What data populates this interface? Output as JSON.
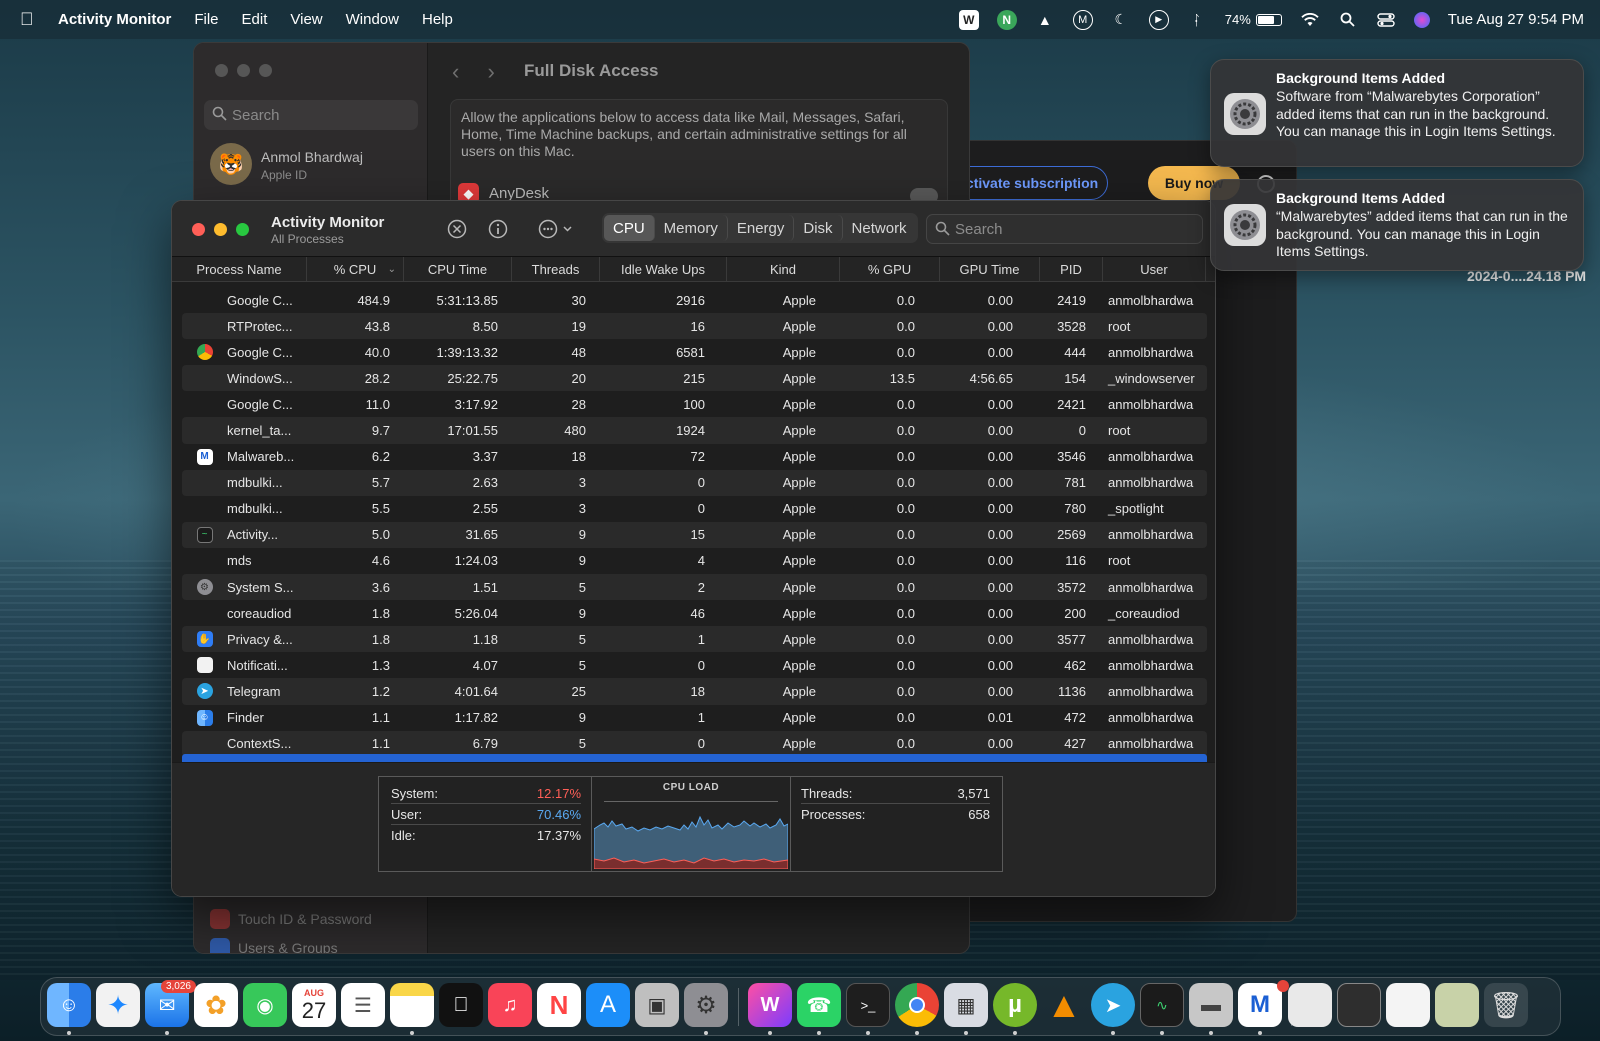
{
  "menubar": {
    "app_name": "Activity Monitor",
    "menus": [
      "File",
      "Edit",
      "View",
      "Window",
      "Help"
    ],
    "battery": "74%",
    "clock": "Tue Aug 27  9:54 PM"
  },
  "settings_window": {
    "search_placeholder": "Search",
    "user_name": "Anmol Bhardwaj",
    "user_sub": "Apple ID",
    "pane_title": "Full Disk Access",
    "description": "Allow the applications below to access data like Mail, Messages, Safari, Home, Time Machine backups, and certain administrative settings for all users on this Mac.",
    "app_row": "AnyDesk",
    "sidebar_bottom": [
      "Touch ID & Password",
      "Users & Groups"
    ]
  },
  "malwarebytes_window": {
    "activate_label": "Activate subscription",
    "buy_label": "Buy now",
    "timestamp": "2024-0....24.18 PM"
  },
  "activity_monitor": {
    "title": "Activity Monitor",
    "subtitle": "All Processes",
    "tabs": [
      "CPU",
      "Memory",
      "Energy",
      "Disk",
      "Network"
    ],
    "active_tab": "CPU",
    "search_placeholder": "Search",
    "columns": [
      "Process Name",
      "% CPU",
      "CPU Time",
      "Threads",
      "Idle Wake Ups",
      "Kind",
      "% GPU",
      "GPU Time",
      "PID",
      "User"
    ],
    "rows": [
      {
        "icon": "",
        "name": "Google C...",
        "cpu": "484.9",
        "cpu_time": "5:31:13.85",
        "threads": "30",
        "idle": "2916",
        "kind": "Apple",
        "gpu": "0.0",
        "gpu_time": "0.00",
        "pid": "2419",
        "user": "anmolbhardwa"
      },
      {
        "icon": "",
        "name": "RTProtec...",
        "cpu": "43.8",
        "cpu_time": "8.50",
        "threads": "19",
        "idle": "16",
        "kind": "Apple",
        "gpu": "0.0",
        "gpu_time": "0.00",
        "pid": "3528",
        "user": "root"
      },
      {
        "icon": "chrome",
        "name": "Google C...",
        "cpu": "40.0",
        "cpu_time": "1:39:13.32",
        "threads": "48",
        "idle": "6581",
        "kind": "Apple",
        "gpu": "0.0",
        "gpu_time": "0.00",
        "pid": "444",
        "user": "anmolbhardwa"
      },
      {
        "icon": "",
        "name": "WindowS...",
        "cpu": "28.2",
        "cpu_time": "25:22.75",
        "threads": "20",
        "idle": "215",
        "kind": "Apple",
        "gpu": "13.5",
        "gpu_time": "4:56.65",
        "pid": "154",
        "user": "_windowserver"
      },
      {
        "icon": "",
        "name": "Google C...",
        "cpu": "11.0",
        "cpu_time": "3:17.92",
        "threads": "28",
        "idle": "100",
        "kind": "Apple",
        "gpu": "0.0",
        "gpu_time": "0.00",
        "pid": "2421",
        "user": "anmolbhardwa"
      },
      {
        "icon": "",
        "name": "kernel_ta...",
        "cpu": "9.7",
        "cpu_time": "17:01.55",
        "threads": "480",
        "idle": "1924",
        "kind": "Apple",
        "gpu": "0.0",
        "gpu_time": "0.00",
        "pid": "0",
        "user": "root"
      },
      {
        "icon": "malwarebytes",
        "name": "Malwareb...",
        "cpu": "6.2",
        "cpu_time": "3.37",
        "threads": "18",
        "idle": "72",
        "kind": "Apple",
        "gpu": "0.0",
        "gpu_time": "0.00",
        "pid": "3546",
        "user": "anmolbhardwa"
      },
      {
        "icon": "",
        "name": "mdbulki...",
        "cpu": "5.7",
        "cpu_time": "2.63",
        "threads": "3",
        "idle": "0",
        "kind": "Apple",
        "gpu": "0.0",
        "gpu_time": "0.00",
        "pid": "781",
        "user": "anmolbhardwa"
      },
      {
        "icon": "",
        "name": "mdbulki...",
        "cpu": "5.5",
        "cpu_time": "2.55",
        "threads": "3",
        "idle": "0",
        "kind": "Apple",
        "gpu": "0.0",
        "gpu_time": "0.00",
        "pid": "780",
        "user": "_spotlight"
      },
      {
        "icon": "activity",
        "name": "Activity...",
        "cpu": "5.0",
        "cpu_time": "31.65",
        "threads": "9",
        "idle": "15",
        "kind": "Apple",
        "gpu": "0.0",
        "gpu_time": "0.00",
        "pid": "2569",
        "user": "anmolbhardwa"
      },
      {
        "icon": "",
        "name": "mds",
        "cpu": "4.6",
        "cpu_time": "1:24.03",
        "threads": "9",
        "idle": "4",
        "kind": "Apple",
        "gpu": "0.0",
        "gpu_time": "0.00",
        "pid": "116",
        "user": "root"
      },
      {
        "icon": "settings",
        "name": "System S...",
        "cpu": "3.6",
        "cpu_time": "1.51",
        "threads": "5",
        "idle": "2",
        "kind": "Apple",
        "gpu": "0.0",
        "gpu_time": "0.00",
        "pid": "3572",
        "user": "anmolbhardwa"
      },
      {
        "icon": "",
        "name": "coreaudiod",
        "cpu": "1.8",
        "cpu_time": "5:26.04",
        "threads": "9",
        "idle": "46",
        "kind": "Apple",
        "gpu": "0.0",
        "gpu_time": "0.00",
        "pid": "200",
        "user": "_coreaudiod"
      },
      {
        "icon": "privacy",
        "name": "Privacy &...",
        "cpu": "1.8",
        "cpu_time": "1.18",
        "threads": "5",
        "idle": "1",
        "kind": "Apple",
        "gpu": "0.0",
        "gpu_time": "0.00",
        "pid": "3577",
        "user": "anmolbhardwa"
      },
      {
        "icon": "notification",
        "name": "Notificati...",
        "cpu": "1.3",
        "cpu_time": "4.07",
        "threads": "5",
        "idle": "0",
        "kind": "Apple",
        "gpu": "0.0",
        "gpu_time": "0.00",
        "pid": "462",
        "user": "anmolbhardwa"
      },
      {
        "icon": "telegram",
        "name": "Telegram",
        "cpu": "1.2",
        "cpu_time": "4:01.64",
        "threads": "25",
        "idle": "18",
        "kind": "Apple",
        "gpu": "0.0",
        "gpu_time": "0.00",
        "pid": "1136",
        "user": "anmolbhardwa"
      },
      {
        "icon": "finder",
        "name": "Finder",
        "cpu": "1.1",
        "cpu_time": "1:17.82",
        "threads": "9",
        "idle": "1",
        "kind": "Apple",
        "gpu": "0.0",
        "gpu_time": "0.01",
        "pid": "472",
        "user": "anmolbhardwa"
      },
      {
        "icon": "",
        "name": "ContextS...",
        "cpu": "1.1",
        "cpu_time": "6.79",
        "threads": "5",
        "idle": "0",
        "kind": "Apple",
        "gpu": "0.0",
        "gpu_time": "0.00",
        "pid": "427",
        "user": "anmolbhardwa"
      }
    ],
    "stats": {
      "system_label": "System:",
      "system_value": "12.17%",
      "system_color": "#ff5f57",
      "user_label": "User:",
      "user_value": "70.46%",
      "user_color": "#5aa9f2",
      "idle_label": "Idle:",
      "idle_value": "17.37%",
      "cpu_load_label": "CPU LOAD",
      "threads_label": "Threads:",
      "threads_value": "3,571",
      "processes_label": "Processes:",
      "processes_value": "658"
    }
  },
  "notifications": [
    {
      "title": "Background Items Added",
      "body": "Software from “Malwarebytes Corporation” added items that can run in the background. You can manage this in Login Items Settings."
    },
    {
      "title": "Background Items Added",
      "body": "“Malwarebytes” added items that can run in the background. You can manage this in Login Items Settings."
    }
  ],
  "dock": {
    "mail_badge": "3,026",
    "calendar_month": "AUG",
    "calendar_day": "27"
  }
}
